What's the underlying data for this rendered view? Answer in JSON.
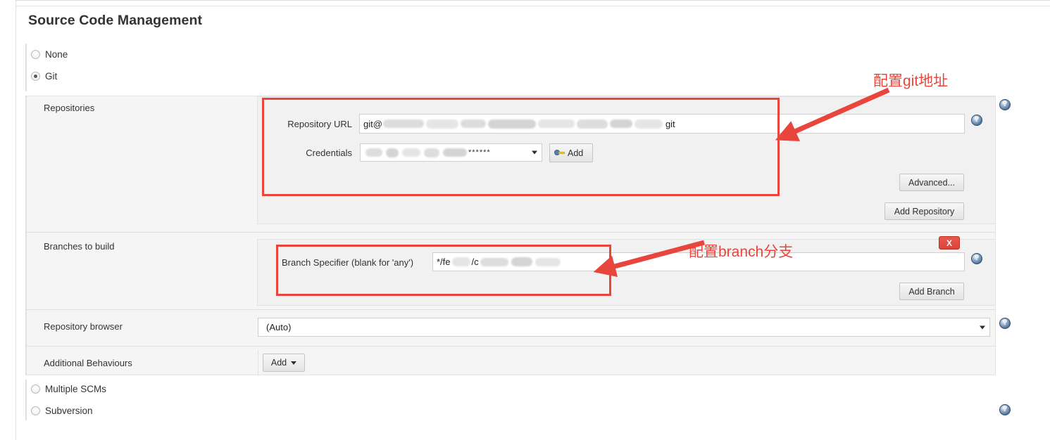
{
  "page": {
    "title": "Source Code Management"
  },
  "scm_options": [
    {
      "label": "None",
      "checked": false
    },
    {
      "label": "Git",
      "checked": true
    },
    {
      "label": "Multiple SCMs",
      "checked": false
    },
    {
      "label": "Subversion",
      "checked": false
    }
  ],
  "rows": {
    "repositories_label": "Repositories",
    "branches_label": "Branches to build",
    "repo_browser_label": "Repository browser",
    "additional_behaviours_label": "Additional Behaviours"
  },
  "repository": {
    "url_label": "Repository URL",
    "url_prefix": "git@",
    "url_suffix": "git",
    "credentials_label": "Credentials",
    "credentials_masked": "******",
    "add_credentials_label": "Add",
    "add_credentials_icon": "key-icon",
    "advanced_label": "Advanced...",
    "add_repository_label": "Add Repository"
  },
  "branches": {
    "specifier_label": "Branch Specifier (blank for 'any')",
    "specifier_value_part1": "*/fe",
    "specifier_value_part2": "/c",
    "add_branch_label": "Add Branch",
    "delete_label": "X"
  },
  "repo_browser": {
    "selected": "(Auto)",
    "caret_icon": "chevron-down-icon"
  },
  "additional_behaviours": {
    "add_label": "Add",
    "caret_icon": "chevron-down-icon"
  },
  "help": {
    "glyph": "?",
    "icon_name": "help-icon"
  },
  "annotations": [
    {
      "text": "配置git地址",
      "color": "#e8463c"
    },
    {
      "text": "配置branch分支",
      "color": "#e8463c"
    }
  ]
}
